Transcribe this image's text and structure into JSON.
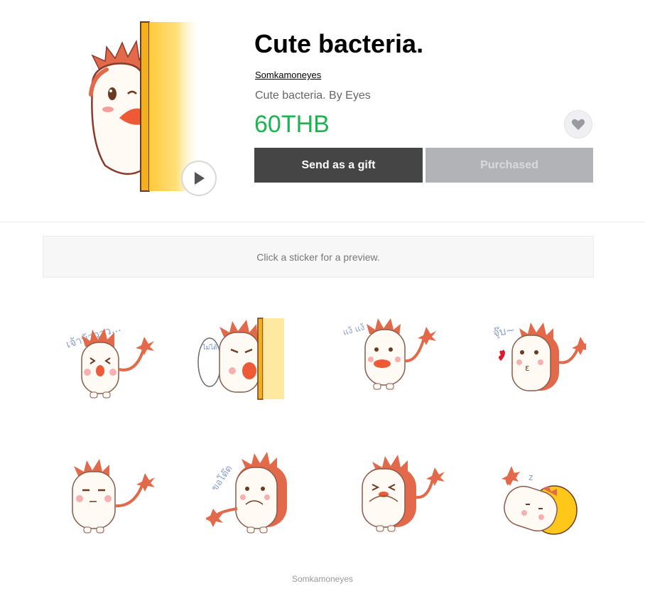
{
  "product": {
    "title": "Cute bacteria.",
    "author": "Somkamoneyes",
    "description": "Cute bacteria. By Eyes",
    "price": "60THB"
  },
  "actions": {
    "gift_label": "Send as a gift",
    "purchased_label": "Purchased"
  },
  "preview": {
    "hint": "Click a sticker for a preview."
  },
  "stickers": {
    "captions": [
      "เจ้าบ้าววว...",
      "ไม่ได้นะจ๊ะ!",
      "แง้ แง้",
      "จุ๊บ~",
      "ขอโต๊ด"
    ]
  },
  "footer": {
    "copyright": "Somkamoneyes"
  },
  "colors": {
    "price": "#1db34f",
    "gift_button": "#454545",
    "purchased_button": "#b2b3b6",
    "sticker_body": "#e2694a"
  }
}
